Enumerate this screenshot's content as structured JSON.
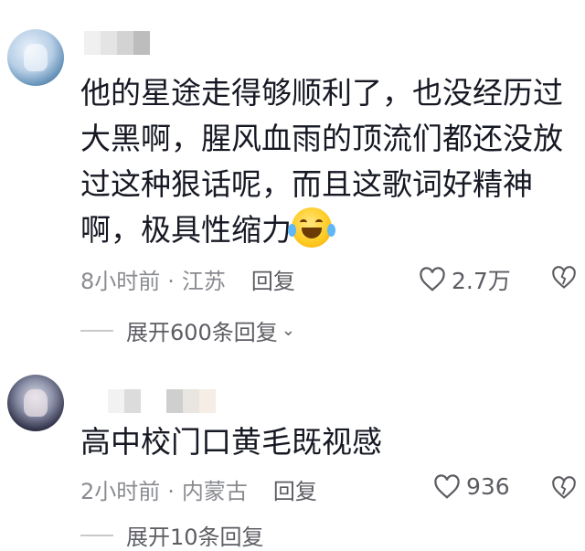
{
  "comments": [
    {
      "text": "他的星途走得够顺利了，也没经历过大黑啊，腥风血雨的顶流们都还没放过这种狠话呢，而且这歌词好精神啊，极具性缩力",
      "emoji": "laughing-tears-emoji",
      "time": "8小时前",
      "location": "江苏",
      "reply_label": "回复",
      "likes": "2.7万",
      "expand_label": "展开600条回复"
    },
    {
      "text": "高中校门口黄毛既视感",
      "time": "2小时前",
      "location": "内蒙古",
      "reply_label": "回复",
      "likes": "936",
      "expand_label": "展开10条回复"
    }
  ],
  "separator": "·",
  "icons": {
    "like": "heart-outline-icon",
    "dislike": "broken-heart-icon",
    "chevron": "chevron-down-icon"
  },
  "colors": {
    "text": "#161823",
    "meta": "#8a8b91",
    "secondary": "#5c5d63"
  }
}
